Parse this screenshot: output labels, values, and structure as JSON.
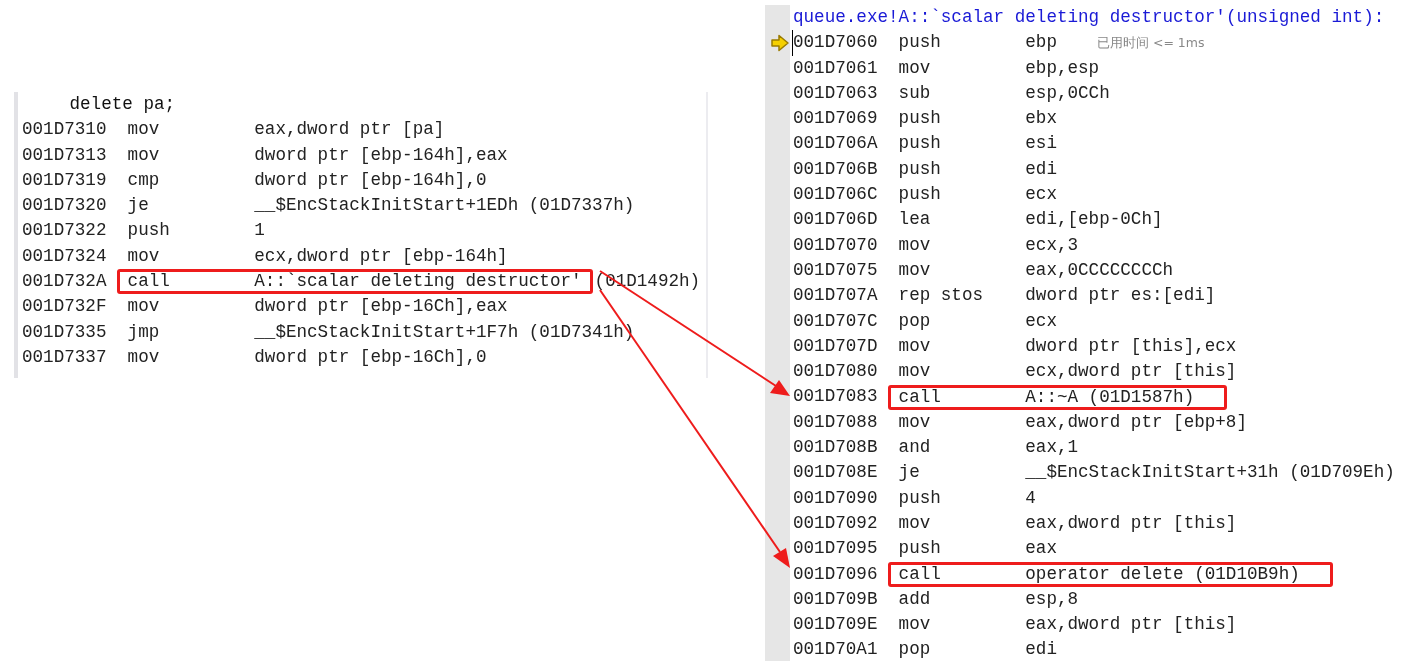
{
  "left_panel": {
    "source_line": "delete pa;",
    "rows": [
      {
        "address": "001D7310",
        "mnemonic": "mov",
        "operand": "eax,dword ptr [pa]",
        "highlighted": false
      },
      {
        "address": "001D7313",
        "mnemonic": "mov",
        "operand": "dword ptr [ebp-164h],eax",
        "highlighted": false
      },
      {
        "address": "001D7319",
        "mnemonic": "cmp",
        "operand": "dword ptr [ebp-164h],0",
        "highlighted": false
      },
      {
        "address": "001D7320",
        "mnemonic": "je",
        "operand": "__$EncStackInitStart+1EDh (01D7337h)",
        "highlighted": false
      },
      {
        "address": "001D7322",
        "mnemonic": "push",
        "operand": "1",
        "highlighted": false
      },
      {
        "address": "001D7324",
        "mnemonic": "mov",
        "operand": "ecx,dword ptr [ebp-164h]",
        "highlighted": false
      },
      {
        "address": "001D732A",
        "mnemonic": "call",
        "operand": "A::`scalar deleting destructor'",
        "target": "(01D1492h)",
        "highlighted": true
      },
      {
        "address": "001D732F",
        "mnemonic": "mov",
        "operand": "dword ptr [ebp-16Ch],eax",
        "highlighted": false
      },
      {
        "address": "001D7335",
        "mnemonic": "jmp",
        "operand": "__$EncStackInitStart+1F7h (01D7341h)",
        "highlighted": false
      },
      {
        "address": "001D7337",
        "mnemonic": "mov",
        "operand": "dword ptr [ebp-16Ch],0",
        "highlighted": false
      }
    ]
  },
  "right_panel": {
    "title": "queue.exe!A::`scalar deleting destructor'(unsigned int):",
    "rows": [
      {
        "address": "001D7060",
        "mnemonic": "push",
        "operand": "ebp",
        "hint": "已用时间 <= 1ms",
        "current": true,
        "highlighted": false
      },
      {
        "address": "001D7061",
        "mnemonic": "mov",
        "operand": "ebp,esp",
        "current": false,
        "highlighted": false
      },
      {
        "address": "001D7063",
        "mnemonic": "sub",
        "operand": "esp,0CCh",
        "current": false,
        "highlighted": false
      },
      {
        "address": "001D7069",
        "mnemonic": "push",
        "operand": "ebx",
        "current": false,
        "highlighted": false
      },
      {
        "address": "001D706A",
        "mnemonic": "push",
        "operand": "esi",
        "current": false,
        "highlighted": false
      },
      {
        "address": "001D706B",
        "mnemonic": "push",
        "operand": "edi",
        "current": false,
        "highlighted": false
      },
      {
        "address": "001D706C",
        "mnemonic": "push",
        "operand": "ecx",
        "current": false,
        "highlighted": false
      },
      {
        "address": "001D706D",
        "mnemonic": "lea",
        "operand": "edi,[ebp-0Ch]",
        "current": false,
        "highlighted": false
      },
      {
        "address": "001D7070",
        "mnemonic": "mov",
        "operand": "ecx,3",
        "current": false,
        "highlighted": false
      },
      {
        "address": "001D7075",
        "mnemonic": "mov",
        "operand": "eax,0CCCCCCCCh",
        "current": false,
        "highlighted": false
      },
      {
        "address": "001D707A",
        "mnemonic": "rep stos",
        "operand": "dword ptr es:[edi]",
        "current": false,
        "highlighted": false
      },
      {
        "address": "001D707C",
        "mnemonic": "pop",
        "operand": "ecx",
        "current": false,
        "highlighted": false
      },
      {
        "address": "001D707D",
        "mnemonic": "mov",
        "operand": "dword ptr [this],ecx",
        "current": false,
        "highlighted": false
      },
      {
        "address": "001D7080",
        "mnemonic": "mov",
        "operand": "ecx,dword ptr [this]",
        "current": false,
        "highlighted": false
      },
      {
        "address": "001D7083",
        "mnemonic": "call",
        "operand": "A::~A (01D1587h)",
        "current": false,
        "highlighted": true
      },
      {
        "address": "001D7088",
        "mnemonic": "mov",
        "operand": "eax,dword ptr [ebp+8]",
        "current": false,
        "highlighted": false
      },
      {
        "address": "001D708B",
        "mnemonic": "and",
        "operand": "eax,1",
        "current": false,
        "highlighted": false
      },
      {
        "address": "001D708E",
        "mnemonic": "je",
        "operand": "__$EncStackInitStart+31h (01D709Eh)",
        "current": false,
        "highlighted": false
      },
      {
        "address": "001D7090",
        "mnemonic": "push",
        "operand": "4",
        "current": false,
        "highlighted": false
      },
      {
        "address": "001D7092",
        "mnemonic": "mov",
        "operand": "eax,dword ptr [this]",
        "current": false,
        "highlighted": false
      },
      {
        "address": "001D7095",
        "mnemonic": "push",
        "operand": "eax",
        "current": false,
        "highlighted": false
      },
      {
        "address": "001D7096",
        "mnemonic": "call",
        "operand": "operator delete (01D10B9h)",
        "current": false,
        "highlighted": true
      },
      {
        "address": "001D709B",
        "mnemonic": "add",
        "operand": "esp,8",
        "current": false,
        "highlighted": false
      },
      {
        "address": "001D709E",
        "mnemonic": "mov",
        "operand": "eax,dword ptr [this]",
        "current": false,
        "highlighted": false
      },
      {
        "address": "001D70A1",
        "mnemonic": "pop",
        "operand": "edi",
        "current": false,
        "highlighted": false
      }
    ]
  }
}
